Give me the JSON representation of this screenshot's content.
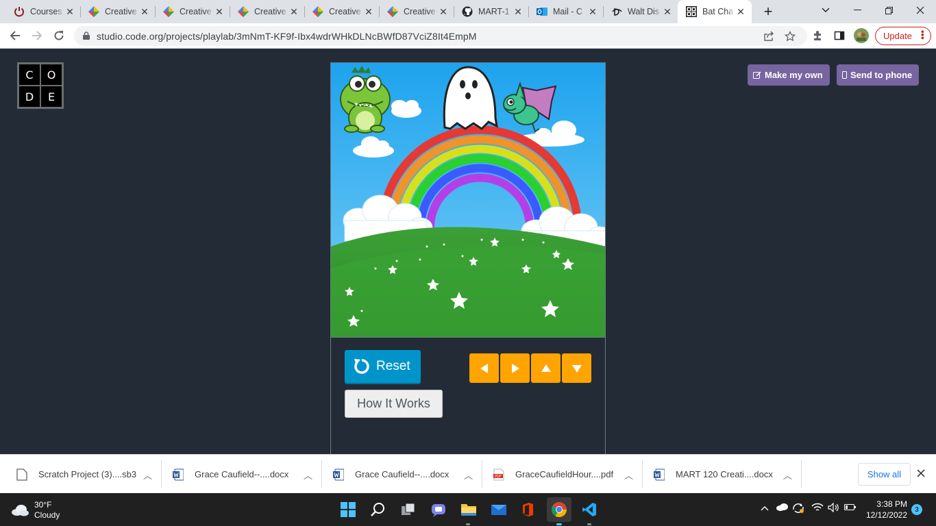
{
  "browser": {
    "tabs": [
      {
        "title": "Courses",
        "icon": "power-icon"
      },
      {
        "title": "Creative",
        "icon": "colorful-diamond-icon"
      },
      {
        "title": "Creative",
        "icon": "colorful-diamond-icon"
      },
      {
        "title": "Creative",
        "icon": "colorful-diamond-icon"
      },
      {
        "title": "Creative",
        "icon": "colorful-diamond-icon"
      },
      {
        "title": "Creative",
        "icon": "colorful-diamond-icon"
      },
      {
        "title": "MART-1",
        "icon": "github-icon"
      },
      {
        "title": "Mail - C",
        "icon": "outlook-icon"
      },
      {
        "title": "Walt Dis",
        "icon": "disney-icon"
      },
      {
        "title": "Bat Cha",
        "icon": "code-org-icon",
        "active": true
      }
    ],
    "new_tab": "+",
    "url": "studio.code.org/projects/playlab/3mNmT-KF9f-Ibx4wdrWHkDLNcBWfD87VciZ8It4EmpM",
    "update_label": "Update"
  },
  "page": {
    "logo_letters": [
      "C",
      "O",
      "D",
      "E"
    ],
    "make_my_own": "Make my own",
    "send_to_phone": "Send to phone",
    "reset_label": "Reset",
    "how_it_works": "How It Works",
    "arrow_buttons": [
      "left-arrow",
      "right-arrow",
      "up-arrow",
      "down-arrow"
    ]
  },
  "downloads": {
    "items": [
      {
        "name": "Scratch Project (3)....sb3",
        "icon": "file-icon"
      },
      {
        "name": "Grace Caufield--....docx",
        "icon": "word-icon"
      },
      {
        "name": "Grace Caufield--....docx",
        "icon": "word-icon"
      },
      {
        "name": "GraceCaufieldHour....pdf",
        "icon": "pdf-icon"
      },
      {
        "name": "MART 120 Creati....docx",
        "icon": "word-icon"
      }
    ],
    "show_all": "Show all"
  },
  "taskbar": {
    "temperature": "30°F",
    "condition": "Cloudy",
    "time": "3:38 PM",
    "date": "12/12/2022",
    "notifications": "3"
  },
  "colors": {
    "page_bg": "#232c36",
    "reset_blue": "#0094ca",
    "arrow_orange": "#ffa400",
    "purple_button": "#7665a0"
  }
}
